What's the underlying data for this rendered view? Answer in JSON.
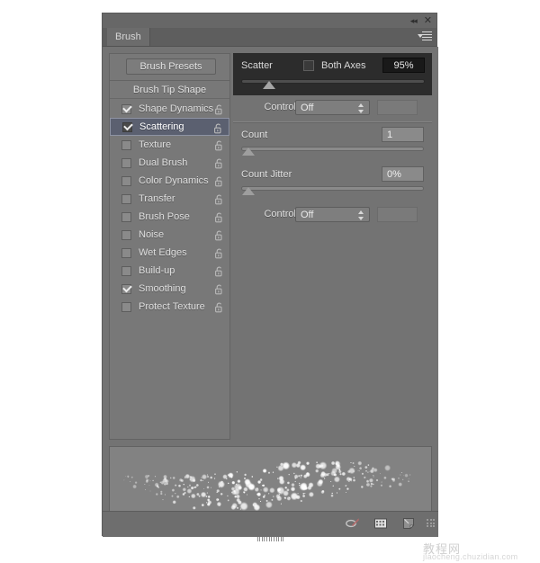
{
  "window": {
    "collapse_icon": "collapse-double-arrow-icon",
    "close_icon": "close-icon",
    "tab_label": "Brush",
    "menu_icon": "panel-menu-icon"
  },
  "left_panel": {
    "presets_button": "Brush Presets",
    "brush_tip_shape": "Brush Tip Shape",
    "options": [
      {
        "label": "Shape Dynamics",
        "checked": true,
        "selected": false,
        "lock": "unlocked-padlock-icon"
      },
      {
        "label": "Scattering",
        "checked": true,
        "selected": true,
        "lock": "unlocked-padlock-icon"
      },
      {
        "label": "Texture",
        "checked": false,
        "selected": false,
        "lock": "unlocked-padlock-icon"
      },
      {
        "label": "Dual Brush",
        "checked": false,
        "selected": false,
        "lock": "unlocked-padlock-icon"
      },
      {
        "label": "Color Dynamics",
        "checked": false,
        "selected": false,
        "lock": "unlocked-padlock-icon"
      },
      {
        "label": "Transfer",
        "checked": false,
        "selected": false,
        "lock": "unlocked-padlock-icon"
      },
      {
        "label": "Brush Pose",
        "checked": false,
        "selected": false,
        "lock": "unlocked-padlock-icon"
      },
      {
        "label": "Noise",
        "checked": false,
        "selected": false,
        "lock": "unlocked-padlock-icon"
      },
      {
        "label": "Wet Edges",
        "checked": false,
        "selected": false,
        "lock": "unlocked-padlock-icon"
      },
      {
        "label": "Build-up",
        "checked": false,
        "selected": false,
        "lock": "unlocked-padlock-icon"
      },
      {
        "label": "Smoothing",
        "checked": true,
        "selected": false,
        "lock": "unlocked-padlock-icon"
      },
      {
        "label": "Protect Texture",
        "checked": false,
        "selected": false,
        "lock": "unlocked-padlock-icon"
      }
    ]
  },
  "scattering": {
    "scatter_label": "Scatter",
    "both_axes_label": "Both Axes",
    "both_axes_checked": false,
    "scatter_value": "95%",
    "scatter_slider_pct": 12,
    "scatter_control_label": "Control:",
    "scatter_control_value": "Off",
    "count_label": "Count",
    "count_value": "1",
    "count_slider_pct": 0,
    "count_jitter_label": "Count Jitter",
    "count_jitter_value": "0%",
    "count_jitter_slider_pct": 0,
    "jitter_control_label": "Control:",
    "jitter_control_value": "Off"
  },
  "bottom_bar": {
    "icons": [
      {
        "name": "create-new-brush-preset-icon"
      },
      {
        "name": "toggle-brush-panel-icon"
      },
      {
        "name": "new-brush-icon"
      }
    ],
    "grip": "resize-grip-icon"
  },
  "watermark": {
    "cn_text": "教程网",
    "url_text": "jiaocheng.chuzidian.com"
  },
  "colors": {
    "panel_bg": "#737373",
    "dark_block": "#2c2c2c",
    "selection": "#5b6070",
    "text": "#dedede"
  }
}
